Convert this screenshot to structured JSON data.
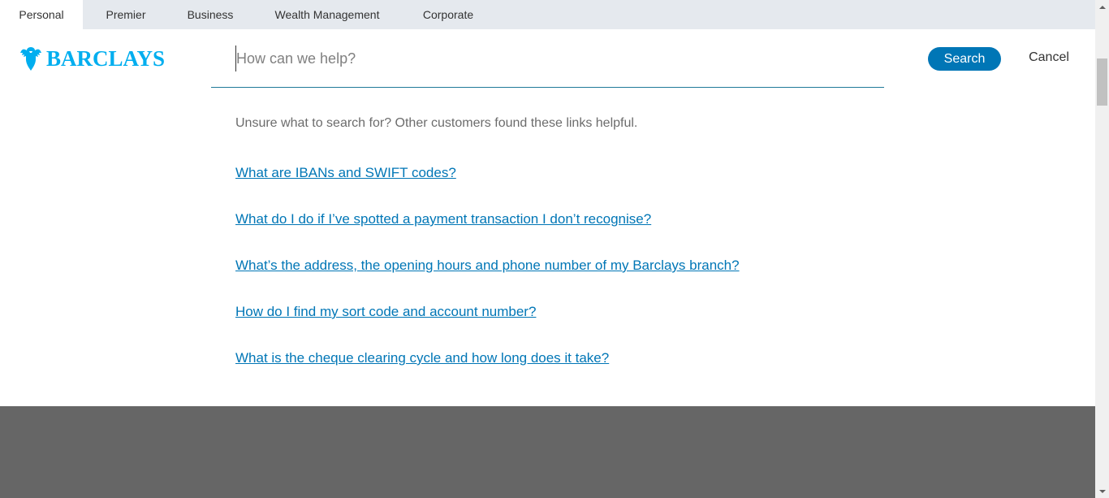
{
  "segments": {
    "tabs": [
      {
        "label": "Personal",
        "active": true
      },
      {
        "label": "Premier",
        "active": false
      },
      {
        "label": "Business",
        "active": false
      },
      {
        "label": "Wealth Management",
        "active": false
      },
      {
        "label": "Corporate",
        "active": false
      }
    ]
  },
  "brand": {
    "name": "BARCLAYS",
    "color": "#00aeef"
  },
  "search": {
    "placeholder": "How can we help?",
    "value": "",
    "submit_label": "Search",
    "cancel_label": "Cancel",
    "button_color": "#0076b6"
  },
  "suggestions": {
    "intro": "Unsure what to search for? Other customers found these links helpful.",
    "links": [
      "What are IBANs and SWIFT codes?",
      "What do I do if I’ve spotted a payment transaction I don’t recognise?",
      "What’s the address, the opening hours and phone number of my Barclays branch?",
      "How do I find my sort code and account number?",
      "What is the cheque clearing cycle and how long does it take?"
    ]
  },
  "colors": {
    "link": "#0076b6",
    "footer_band": "#666666",
    "tab_bar": "#e5e9ee"
  }
}
